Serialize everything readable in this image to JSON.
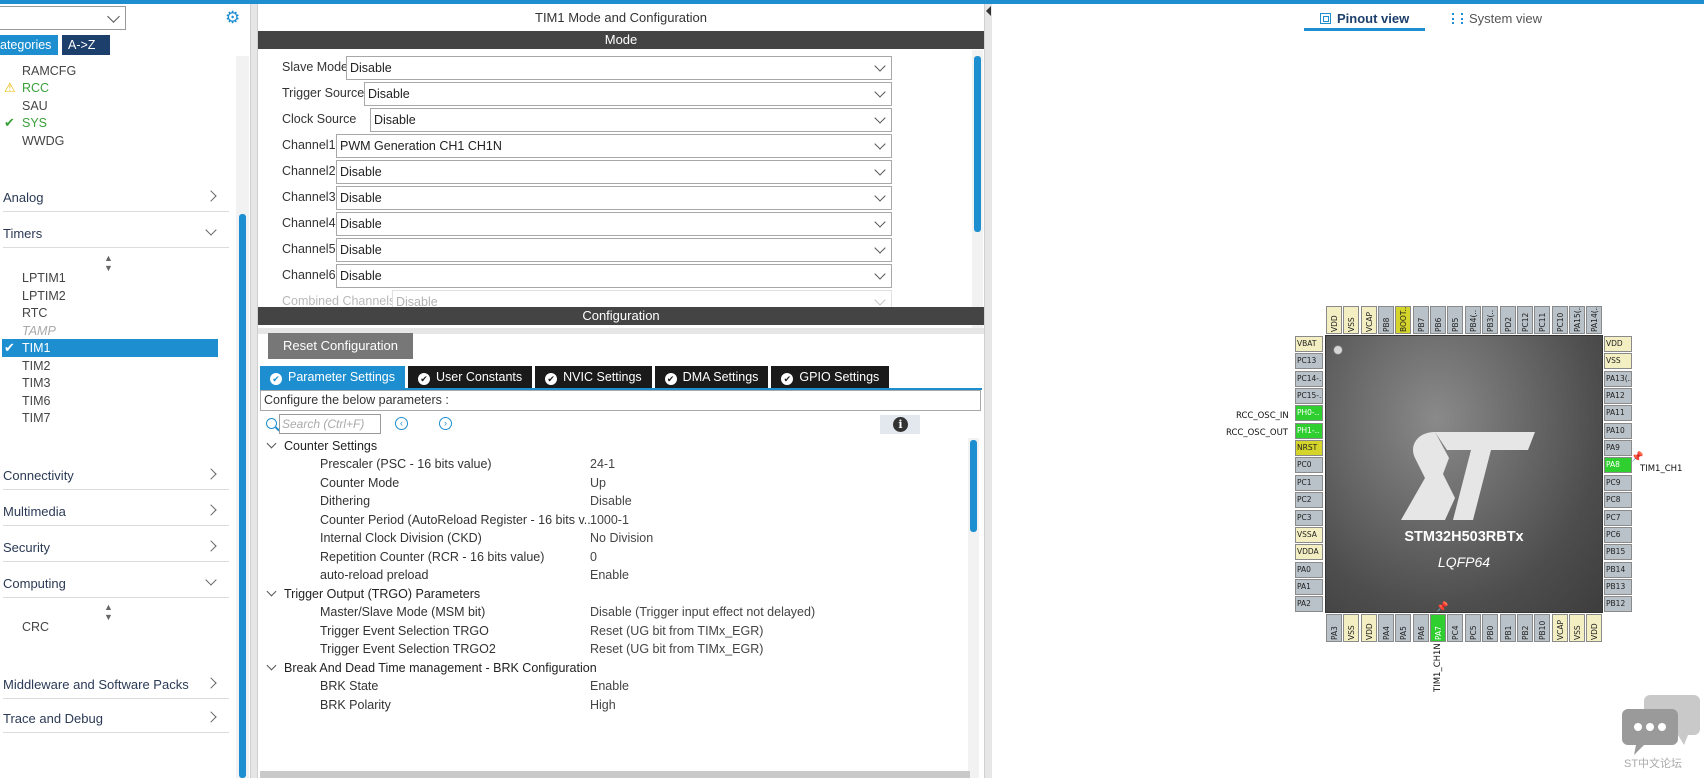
{
  "left": {
    "combo_value": "",
    "tabs": [
      "ategories",
      "A->Z"
    ],
    "items_top": [
      {
        "label": "RAMCFG",
        "state": "none"
      },
      {
        "label": "RCC",
        "state": "warn"
      },
      {
        "label": "SAU",
        "state": "none"
      },
      {
        "label": "SYS",
        "state": "ok"
      },
      {
        "label": "WWDG",
        "state": "none"
      }
    ],
    "categories": {
      "analog": "Analog",
      "timers": "Timers",
      "connectivity": "Connectivity",
      "multimedia": "Multimedia",
      "security": "Security",
      "computing": "Computing",
      "middleware": "Middleware and Software Packs",
      "trace": "Trace and Debug"
    },
    "timers": [
      "LPTIM1",
      "LPTIM2",
      "RTC",
      "TAMP",
      "TIM1",
      "TIM2",
      "TIM3",
      "TIM6",
      "TIM7"
    ],
    "computing": [
      "CRC"
    ]
  },
  "middle": {
    "title": "TIM1 Mode and Configuration",
    "mode_header": "Mode",
    "mode_rows": [
      {
        "label": "Slave Mode",
        "value": "Disable"
      },
      {
        "label": "Trigger Source",
        "value": "Disable"
      },
      {
        "label": "Clock Source",
        "value": "Disable"
      },
      {
        "label": "Channel1",
        "value": "PWM Generation CH1 CH1N"
      },
      {
        "label": "Channel2",
        "value": "Disable"
      },
      {
        "label": "Channel3",
        "value": "Disable"
      },
      {
        "label": "Channel4",
        "value": "Disable"
      },
      {
        "label": "Channel5",
        "value": "Disable"
      },
      {
        "label": "Channel6",
        "value": "Disable"
      },
      {
        "label": "Combined Channels",
        "value": "Disable"
      }
    ],
    "config_header": "Configuration",
    "reset_button": "Reset Configuration",
    "tabs": [
      "Parameter Settings",
      "User Constants",
      "NVIC Settings",
      "DMA Settings",
      "GPIO Settings"
    ],
    "configure_text": "Configure the below parameters :",
    "search_placeholder": "Search (Ctrl+F)",
    "info_glyph": "i",
    "groups": [
      {
        "title": "Counter Settings",
        "params": [
          {
            "name": "Prescaler (PSC - 16 bits value)",
            "value": "24-1"
          },
          {
            "name": "Counter Mode",
            "value": "Up"
          },
          {
            "name": "Dithering",
            "value": "Disable"
          },
          {
            "name": "Counter Period (AutoReload Register - 16 bits v...",
            "value": "1000-1"
          },
          {
            "name": "Internal Clock Division (CKD)",
            "value": "No Division"
          },
          {
            "name": "Repetition Counter (RCR - 16 bits value)",
            "value": "0"
          },
          {
            "name": "auto-reload preload",
            "value": "Enable"
          }
        ]
      },
      {
        "title": "Trigger Output (TRGO) Parameters",
        "params": [
          {
            "name": "Master/Slave Mode (MSM bit)",
            "value": "Disable (Trigger input effect not delayed)"
          },
          {
            "name": "Trigger Event Selection TRGO",
            "value": "Reset (UG bit from TIMx_EGR)"
          },
          {
            "name": "Trigger Event Selection TRGO2",
            "value": "Reset (UG bit from TIMx_EGR)"
          }
        ]
      },
      {
        "title": "Break And Dead Time management - BRK Configuration",
        "params": [
          {
            "name": "BRK State",
            "value": "Enable"
          },
          {
            "name": "BRK Polarity",
            "value": "High"
          }
        ]
      }
    ]
  },
  "right": {
    "tabs": [
      "Pinout view",
      "System view"
    ],
    "chip_name": "STM32H503RBTx",
    "package": "LQFP64",
    "pins_top": [
      {
        "label": "VDD",
        "color": "beige"
      },
      {
        "label": "VSS",
        "color": "beige"
      },
      {
        "label": "VCAP",
        "color": "beige"
      },
      {
        "label": "PB8",
        "color": "gray"
      },
      {
        "label": "BOOT..",
        "color": "yellow"
      },
      {
        "label": "PB7",
        "color": "gray"
      },
      {
        "label": "PB6",
        "color": "gray"
      },
      {
        "label": "PB5",
        "color": "gray"
      },
      {
        "label": "PB4(..",
        "color": "gray"
      },
      {
        "label": "PB3(..",
        "color": "gray"
      },
      {
        "label": "PD2",
        "color": "gray"
      },
      {
        "label": "PC12",
        "color": "gray"
      },
      {
        "label": "PC11",
        "color": "gray"
      },
      {
        "label": "PC10",
        "color": "gray"
      },
      {
        "label": "PA15(..",
        "color": "gray"
      },
      {
        "label": "PA14(..",
        "color": "gray"
      }
    ],
    "pins_left": [
      {
        "label": "VBAT",
        "color": "beige"
      },
      {
        "label": "PC13",
        "color": "gray"
      },
      {
        "label": "PC14-..",
        "color": "gray"
      },
      {
        "label": "PC15-..",
        "color": "gray"
      },
      {
        "label": "PH0-..",
        "color": "green"
      },
      {
        "label": "PH1-..",
        "color": "green"
      },
      {
        "label": "NRST",
        "color": "yellow"
      },
      {
        "label": "PC0",
        "color": "gray"
      },
      {
        "label": "PC1",
        "color": "gray"
      },
      {
        "label": "PC2",
        "color": "gray"
      },
      {
        "label": "PC3",
        "color": "gray"
      },
      {
        "label": "VSSA",
        "color": "beige"
      },
      {
        "label": "VDDA",
        "color": "beige"
      },
      {
        "label": "PA0",
        "color": "gray"
      },
      {
        "label": "PA1",
        "color": "gray"
      },
      {
        "label": "PA2",
        "color": "gray"
      }
    ],
    "pins_right": [
      {
        "label": "VDD",
        "color": "beige"
      },
      {
        "label": "VSS",
        "color": "beige"
      },
      {
        "label": "PA13(..",
        "color": "gray"
      },
      {
        "label": "PA12",
        "color": "gray"
      },
      {
        "label": "PA11",
        "color": "gray"
      },
      {
        "label": "PA10",
        "color": "gray"
      },
      {
        "label": "PA9",
        "color": "gray"
      },
      {
        "label": "PA8",
        "color": "green"
      },
      {
        "label": "PC9",
        "color": "gray"
      },
      {
        "label": "PC8",
        "color": "gray"
      },
      {
        "label": "PC7",
        "color": "gray"
      },
      {
        "label": "PC6",
        "color": "gray"
      },
      {
        "label": "PB15",
        "color": "gray"
      },
      {
        "label": "PB14",
        "color": "gray"
      },
      {
        "label": "PB13",
        "color": "gray"
      },
      {
        "label": "PB12",
        "color": "gray"
      }
    ],
    "pins_bottom": [
      {
        "label": "PA3",
        "color": "gray"
      },
      {
        "label": "VSS",
        "color": "beige"
      },
      {
        "label": "VDD",
        "color": "beige"
      },
      {
        "label": "PA4",
        "color": "gray"
      },
      {
        "label": "PA5",
        "color": "gray"
      },
      {
        "label": "PA6",
        "color": "gray"
      },
      {
        "label": "PA7",
        "color": "green"
      },
      {
        "label": "PC4",
        "color": "gray"
      },
      {
        "label": "PC5",
        "color": "gray"
      },
      {
        "label": "PB0",
        "color": "gray"
      },
      {
        "label": "PB1",
        "color": "gray"
      },
      {
        "label": "PB2",
        "color": "gray"
      },
      {
        "label": "PB10",
        "color": "gray"
      },
      {
        "label": "VCAP",
        "color": "beige"
      },
      {
        "label": "VSS",
        "color": "beige"
      },
      {
        "label": "VDD",
        "color": "beige"
      }
    ],
    "signals": {
      "rcc_osc_in": "RCC_OSC_IN",
      "rcc_osc_out": "RCC_OSC_OUT",
      "tim1_ch1": "TIM1_CH1",
      "tim1_ch1n": "TIM1_CH1N"
    },
    "forum_label": "ST中文论坛"
  },
  "colors": {
    "accent": "#1d8fd1",
    "header_dark": "#444444",
    "pin_beige": "#f4efc3",
    "pin_gray": "#b9c2c9",
    "pin_green": "#2fcf2f",
    "pin_yellow": "#d4d42a",
    "status_ok": "#3aa13a",
    "status_warn": "#e8b800"
  }
}
